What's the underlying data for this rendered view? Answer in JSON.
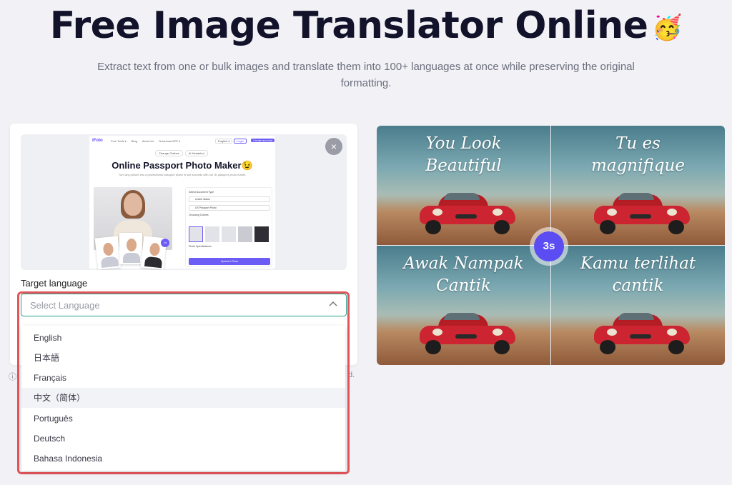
{
  "hero": {
    "title": "Free Image Translator Online",
    "emoji": "🥳",
    "subtitle": "Extract text from one or bulk images and translate them into 100+ languages at once while preserving the original formatting."
  },
  "preview": {
    "close_icon": "×",
    "mini": {
      "logo": "iFoto",
      "nav_links": [
        "Free Tools ▾",
        "Blog",
        "About Us",
        "Download APP ▾"
      ],
      "lang": "English ▾",
      "login": "Login",
      "create": "Create account",
      "tabs": [
        "Change Clothes",
        "AI Headshot"
      ],
      "title": "Online Passport Photo Maker",
      "title_emoji": "😉",
      "desc": "Turn any picture into a professional passport photo in just seconds with our ID passport photo maker.",
      "badge": "1s",
      "form": {
        "doc_type_label": "Select Document Type",
        "country": "United States",
        "doc": "US Passport Photo",
        "clothes_label": "Choosing Clothes",
        "spec_label": "Photo Specifications",
        "button": "Upload a Photo"
      }
    }
  },
  "form": {
    "target_label": "Target language",
    "select_placeholder": "Select Language",
    "chevron_icon": "chevron-up-icon"
  },
  "info": {
    "icon": "ⓘ",
    "trailing": "d."
  },
  "dropdown": {
    "options": [
      "English",
      "日本語",
      "Français",
      "中文（简体）",
      "Português",
      "Deutsch",
      "Bahasa Indonesia"
    ],
    "hovered_index": 3
  },
  "demo": {
    "captions": [
      "You Look\nBeautiful",
      "Tu es\nmagnifique",
      "Awak Nampak\nCantik",
      "Kamu terlihat\ncantik"
    ],
    "timer": "3s"
  },
  "colors": {
    "accent": "#5b4df2",
    "highlight": "#e2555a",
    "select_border": "#2aa08a"
  }
}
